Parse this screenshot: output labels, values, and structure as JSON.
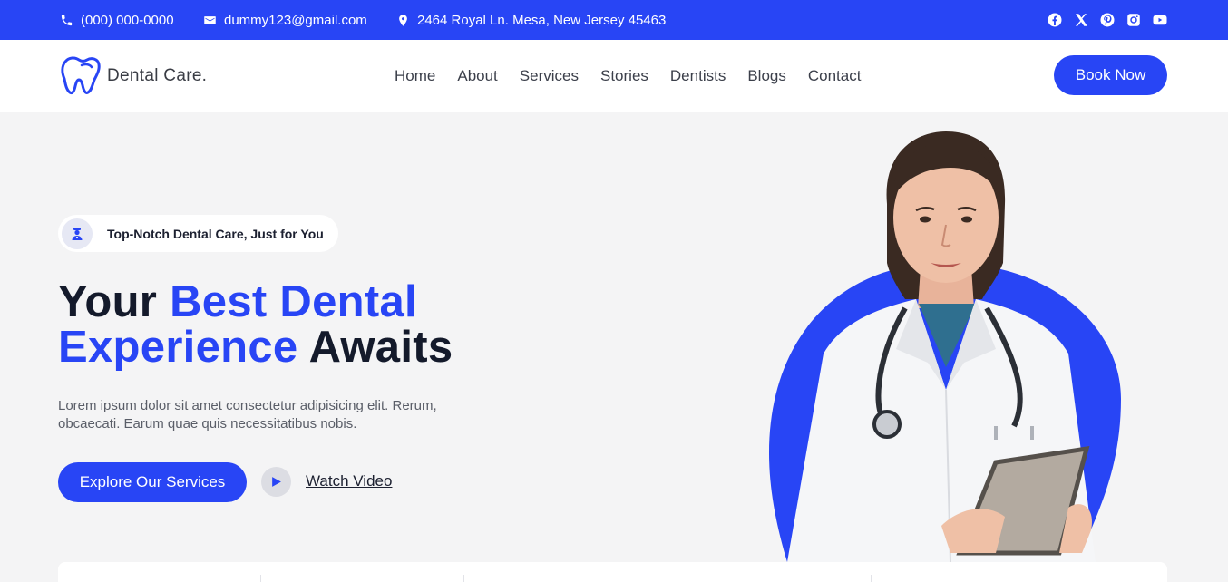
{
  "topbar": {
    "phone": "(000) 000-0000",
    "email": "dummy123@gmail.com",
    "address": "2464 Royal Ln. Mesa, New Jersey 45463",
    "socials": [
      "facebook-icon",
      "x-icon",
      "pinterest-icon",
      "instagram-icon",
      "youtube-icon"
    ]
  },
  "header": {
    "logo_text": "Dental Care.",
    "nav": [
      "Home",
      "About",
      "Services",
      "Stories",
      "Dentists",
      "Blogs",
      "Contact"
    ],
    "cta": "Book Now"
  },
  "hero": {
    "badge": "Top-Notch Dental Care, Just for You",
    "title_part1": "Your ",
    "title_highlight1": "Best Dental",
    "title_highlight2": "Experience",
    "title_part2": " Awaits",
    "description": "Lorem ipsum dolor sit amet consectetur adipisicing elit. Rerum, obcaecati. Earum quae quis necessitatibus nobis.",
    "primary_button": "Explore Our Services",
    "video_link": "Watch Video"
  },
  "colors": {
    "accent": "#2845f5",
    "background": "#f4f4f5",
    "text_dark": "#141a2b"
  }
}
